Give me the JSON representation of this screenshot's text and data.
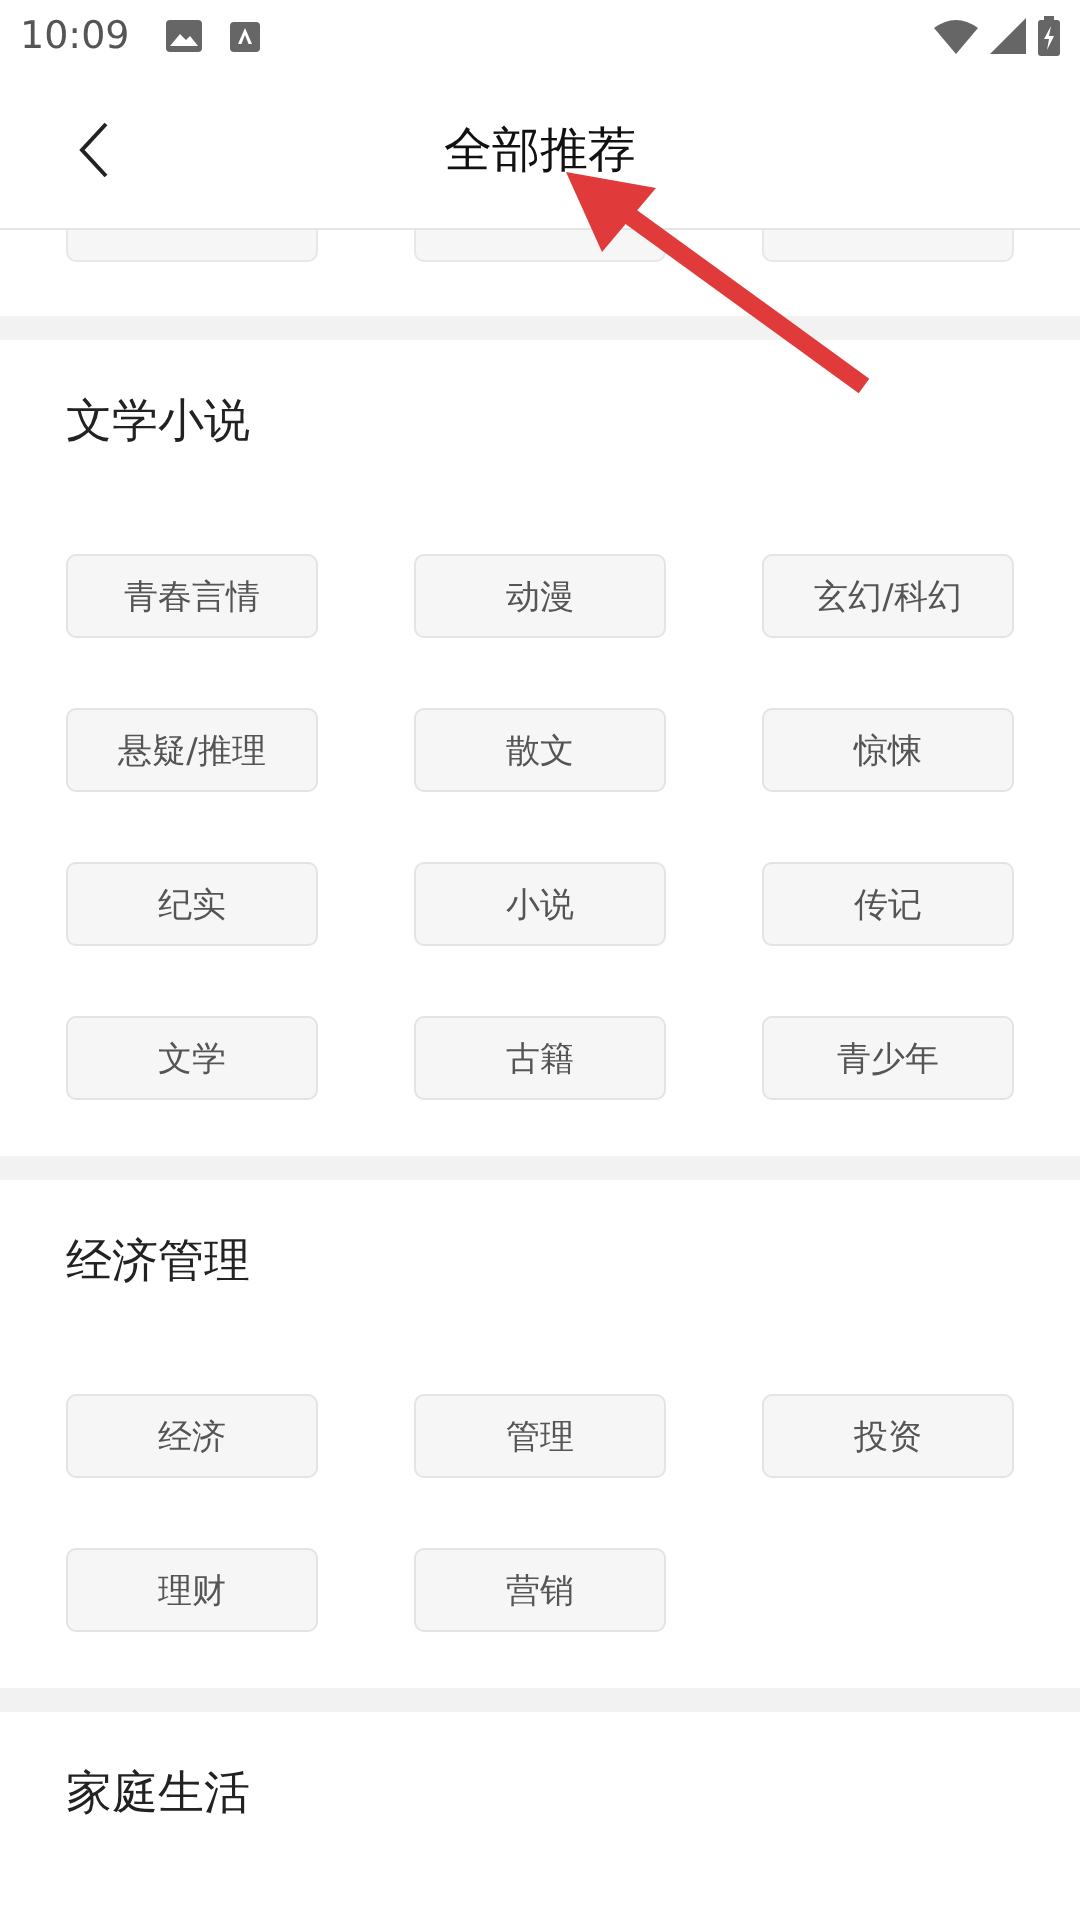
{
  "status_bar": {
    "time": "10:09"
  },
  "header": {
    "title": "全部推荐"
  },
  "cut_row": [
    {
      "kind": "cut"
    },
    {
      "kind": "cut"
    },
    {
      "kind": "cut"
    }
  ],
  "sections": [
    {
      "title": "文学小说",
      "tags": [
        "青春言情",
        "动漫",
        "玄幻/科幻",
        "悬疑/推理",
        "散文",
        "惊悚",
        "纪实",
        "小说",
        "传记",
        "文学",
        "古籍",
        "青少年"
      ]
    },
    {
      "title": "经济管理",
      "tags": [
        "经济",
        "管理",
        "投资",
        "理财",
        "营销"
      ]
    },
    {
      "title": "家庭生活"
    }
  ]
}
